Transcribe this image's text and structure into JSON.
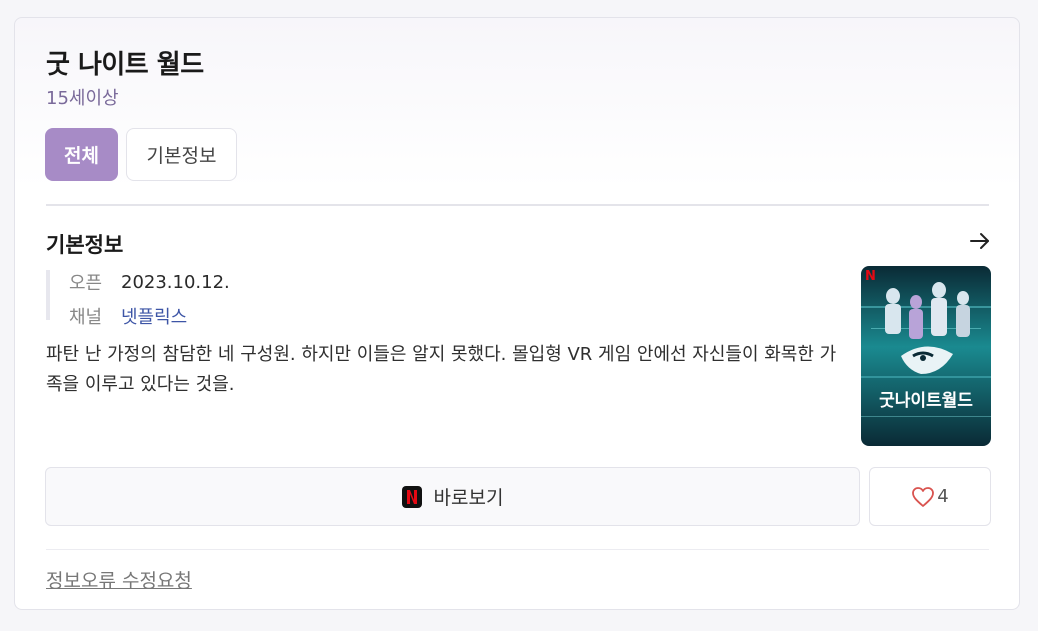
{
  "header": {
    "title": "굿 나이트 월드",
    "rating": "15세이상"
  },
  "tabs": [
    {
      "label": "전체",
      "active": true
    },
    {
      "label": "기본정보",
      "active": false
    }
  ],
  "basic_info": {
    "section_title": "기본정보",
    "arrow_icon": "arrow-right-icon",
    "rows": [
      {
        "key": "오픈",
        "value": "2023.10.12."
      },
      {
        "key": "채널",
        "value": "넷플릭스"
      }
    ],
    "description": "파탄 난 가정의 참담한 네 구성원. 하지만 이들은 알지 못했다. 몰입형 VR 게임 안에선 자신들이 화목한 가족을 이루고 있다는 것을.",
    "poster": {
      "title_text": "굿나이트월드",
      "badge": "N",
      "colors": {
        "background": "#0f6f78",
        "dark": "#0a2a35"
      }
    }
  },
  "actions": {
    "watch_label": "바로보기",
    "watch_icon": "netflix-icon",
    "like_icon": "heart-icon",
    "like_count": "4"
  },
  "footer": {
    "report_label": "정보오류 수정요청"
  },
  "colors": {
    "accent": "#a78bc6",
    "rating": "#7a6a9a",
    "link": "#3d55a6",
    "heart": "#d9534f",
    "netflix_red": "#e50914"
  }
}
